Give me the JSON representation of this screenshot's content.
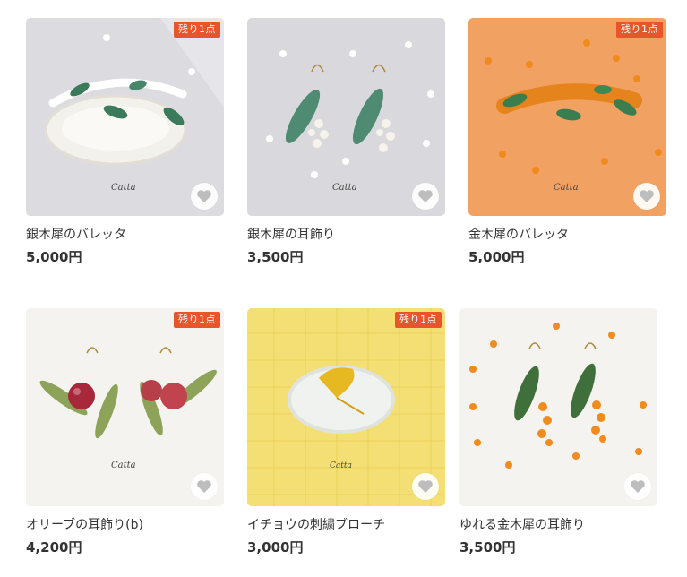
{
  "products": [
    {
      "title": "銀木犀のバレッタ",
      "price": "5,000円",
      "badge": "残り1点"
    },
    {
      "title": "銀木犀の耳飾り",
      "price": "3,500円",
      "badge": ""
    },
    {
      "title": "金木犀のバレッタ",
      "price": "5,000円",
      "badge": "残り1点"
    },
    {
      "title": "オリーブの耳飾り(b)",
      "price": "4,200円",
      "badge": "残り1点"
    },
    {
      "title": "イチョウの刺繍ブローチ",
      "price": "3,000円",
      "badge": "残り1点"
    },
    {
      "title": "ゆれる金木犀の耳飾り",
      "price": "3,500円",
      "badge": ""
    }
  ],
  "photo_signature": "Catta",
  "colors": {
    "badge": "#e8552a",
    "heart": "#bdbdbd",
    "text": "#333333"
  },
  "icons": {
    "favorite": "heart-icon"
  }
}
